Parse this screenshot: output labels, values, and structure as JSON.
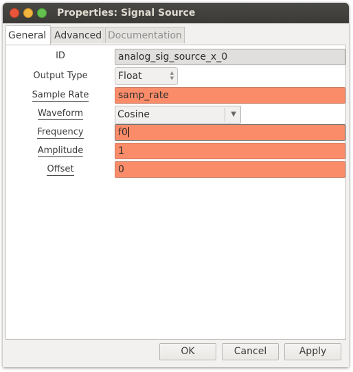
{
  "window": {
    "title": "Properties: Signal Source"
  },
  "tabs": [
    {
      "label": "General",
      "active": true
    },
    {
      "label": "Advanced",
      "active": false
    },
    {
      "label": "Documentation",
      "active": false,
      "disabled": true
    }
  ],
  "fields": {
    "id": {
      "label": "ID",
      "value": "analog_sig_source_x_0"
    },
    "output_type": {
      "label": "Output Type",
      "value": "Float"
    },
    "sample_rate": {
      "label": "Sample Rate",
      "value": "samp_rate"
    },
    "waveform": {
      "label": "Waveform",
      "value": "Cosine"
    },
    "frequency": {
      "label": "Frequency",
      "value": "f0"
    },
    "amplitude": {
      "label": "Amplitude",
      "value": "1"
    },
    "offset": {
      "label": "Offset",
      "value": "0"
    }
  },
  "buttons": {
    "ok": "OK",
    "cancel": "Cancel",
    "apply": "Apply"
  },
  "icons": {
    "spin_arrows": "spin-up-down-icon",
    "combo_arrow": "chevron-down-icon"
  },
  "colors": {
    "titlebar": "#3c3b37",
    "highlight_field": "#fa8c6a",
    "readonly_field": "#e0dfdd",
    "close": "#e8553a",
    "minimize": "#f2b540",
    "maximize": "#66c04f"
  }
}
